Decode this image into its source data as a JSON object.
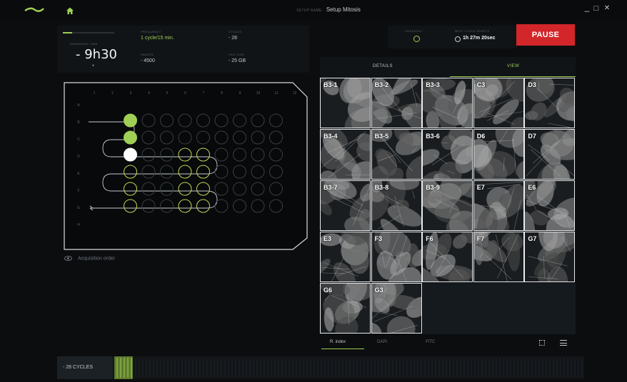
{
  "window": {
    "title_prefix": "SETUP NAME",
    "title": "Setup Mitosis",
    "minimize": "_",
    "maximize": "□",
    "close": "✕"
  },
  "stats": {
    "remaining_label": "REMAINING TIME",
    "remaining_value": "- 9h30",
    "remaining_progress": 0.18,
    "indicator": "●",
    "frequency_label": "FREQUENCY",
    "frequency_value": "1 cycle/15 min.",
    "cycles_label": "CYCLES",
    "cycles_value": "- 28",
    "images_label": "IMAGES",
    "images_value": "- 4500",
    "filesize_label": "FILE SIZE",
    "filesize_value": "- 25 GB"
  },
  "status": {
    "checkout_label": "CHECKOUT",
    "nextcycle_label": "NEXT CYCLE STARTS",
    "nextcycle_value": "1h 27m 20sec",
    "pause_label": "PAUSE"
  },
  "plate": {
    "columns": [
      "1",
      "2",
      "3",
      "4",
      "5",
      "6",
      "7",
      "8",
      "9",
      "10",
      "11",
      "12"
    ],
    "rows": [
      "A",
      "B",
      "C",
      "D",
      "E",
      "F",
      "G",
      "H"
    ],
    "acquisition_label": "Acquisition order"
  },
  "view_tabs": {
    "details": "DETAILS",
    "view": "VIEW"
  },
  "tiles": [
    "B3-1",
    "B3-2",
    "B3-3",
    "C3",
    "D3",
    "B3-4",
    "B3-5",
    "B3-6",
    "D6",
    "D7",
    "B3-7",
    "B3-8",
    "B3-9",
    "E7",
    "E6",
    "E3",
    "F3",
    "F6",
    "F7",
    "G7",
    "G6",
    "G3"
  ],
  "channels": {
    "r_index": "R. index",
    "dapi": "DAPI",
    "fitc": "FITC"
  },
  "timeline": {
    "cycles_label": "- 28 CYCLES"
  },
  "colors": {
    "accent": "#9fcf54",
    "pause": "#d3262a",
    "background": "#0b0d0f"
  }
}
